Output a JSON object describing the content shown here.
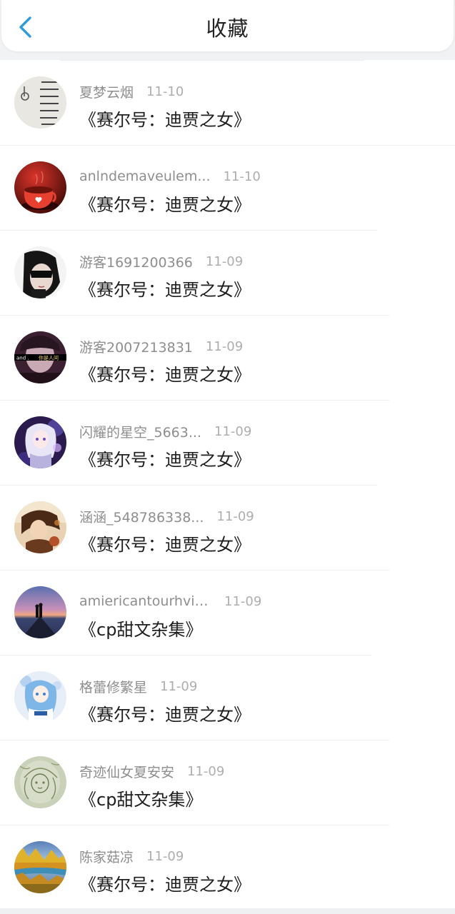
{
  "header": {
    "title": "收藏",
    "back_icon": "chevron-left-icon",
    "accent": "#2e9cdb"
  },
  "favorites": [
    {
      "user": "夏梦云烟",
      "date": "11-10",
      "title": "《赛尔号：迪贾之女》",
      "avatar": "text-paper"
    },
    {
      "user": "anlndemaveulem...",
      "date": "11-10",
      "title": "《赛尔号：迪贾之女》",
      "avatar": "red-cup"
    },
    {
      "user": "游客1691200366",
      "date": "11-09",
      "title": "《赛尔号：迪贾之女》",
      "avatar": "masked-face"
    },
    {
      "user": "游客2007213831",
      "date": "11-09",
      "title": "《赛尔号：迪贾之女》",
      "avatar": "dark-portrait"
    },
    {
      "user": "闪耀的星空_5663...",
      "date": "11-09",
      "title": "《赛尔号：迪贾之女》",
      "avatar": "anime-girl-purple"
    },
    {
      "user": "涵涵_548786338...",
      "date": "11-09",
      "title": "《赛尔号：迪贾之女》",
      "avatar": "anime-boy-warm"
    },
    {
      "user": "amiericantourhvis...",
      "date": "11-09",
      "title": "《cp甜文杂集》",
      "avatar": "sunset-couple"
    },
    {
      "user": "格蕾修繁星",
      "date": "11-09",
      "title": "《赛尔号：迪贾之女》",
      "avatar": "anime-girl-blue"
    },
    {
      "user": "奇迹仙女夏安安",
      "date": "11-09",
      "title": "《cp甜文杂集》",
      "avatar": "sketch-fairy"
    },
    {
      "user": "陈家菇凉",
      "date": "11-09",
      "title": "《赛尔号：迪贾之女》",
      "avatar": "autumn-lake"
    }
  ]
}
